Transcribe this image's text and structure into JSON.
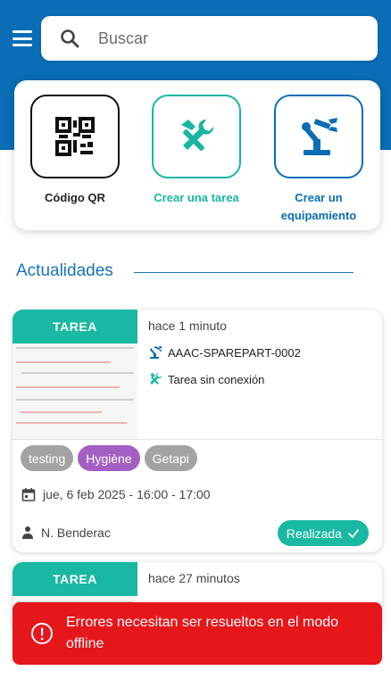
{
  "header": {
    "search_placeholder": "Buscar",
    "icons": {
      "menu": "hamburger-icon",
      "search": "search-icon"
    }
  },
  "quick_actions": [
    {
      "label": "Código QR",
      "icon": "qr-code-icon",
      "color": "#111111"
    },
    {
      "label": "Crear una tarea",
      "icon": "tools-icon",
      "color": "#18b6a0"
    },
    {
      "label": "Crear un equipamiento",
      "icon": "robot-arm-icon",
      "color": "#0a6db5"
    }
  ],
  "section": {
    "title": "Actualidades"
  },
  "cards": [
    {
      "type": "TAREA",
      "time": "hace 1 minuto",
      "equipment": "AAAC-SPAREPART-0002",
      "task": "Tarea sin conexión",
      "tags": [
        "testing",
        "Hygiène",
        "Getapi"
      ],
      "date": "jue, 6 feb 2025 - 16:00 - 17:00",
      "user": "N. Benderac",
      "status": "Realizada"
    },
    {
      "type": "TAREA",
      "time": "hace 27 minutos"
    }
  ],
  "toast": {
    "message": "Errores necesitan ser resueltos en el modo offline",
    "icon": "error-circle-icon"
  },
  "colors": {
    "primary": "#0a6db5",
    "teal": "#19b8a3",
    "purple_tag": "#a35fc1",
    "gray_tag": "#a3a3a3",
    "error": "#e5171b"
  }
}
